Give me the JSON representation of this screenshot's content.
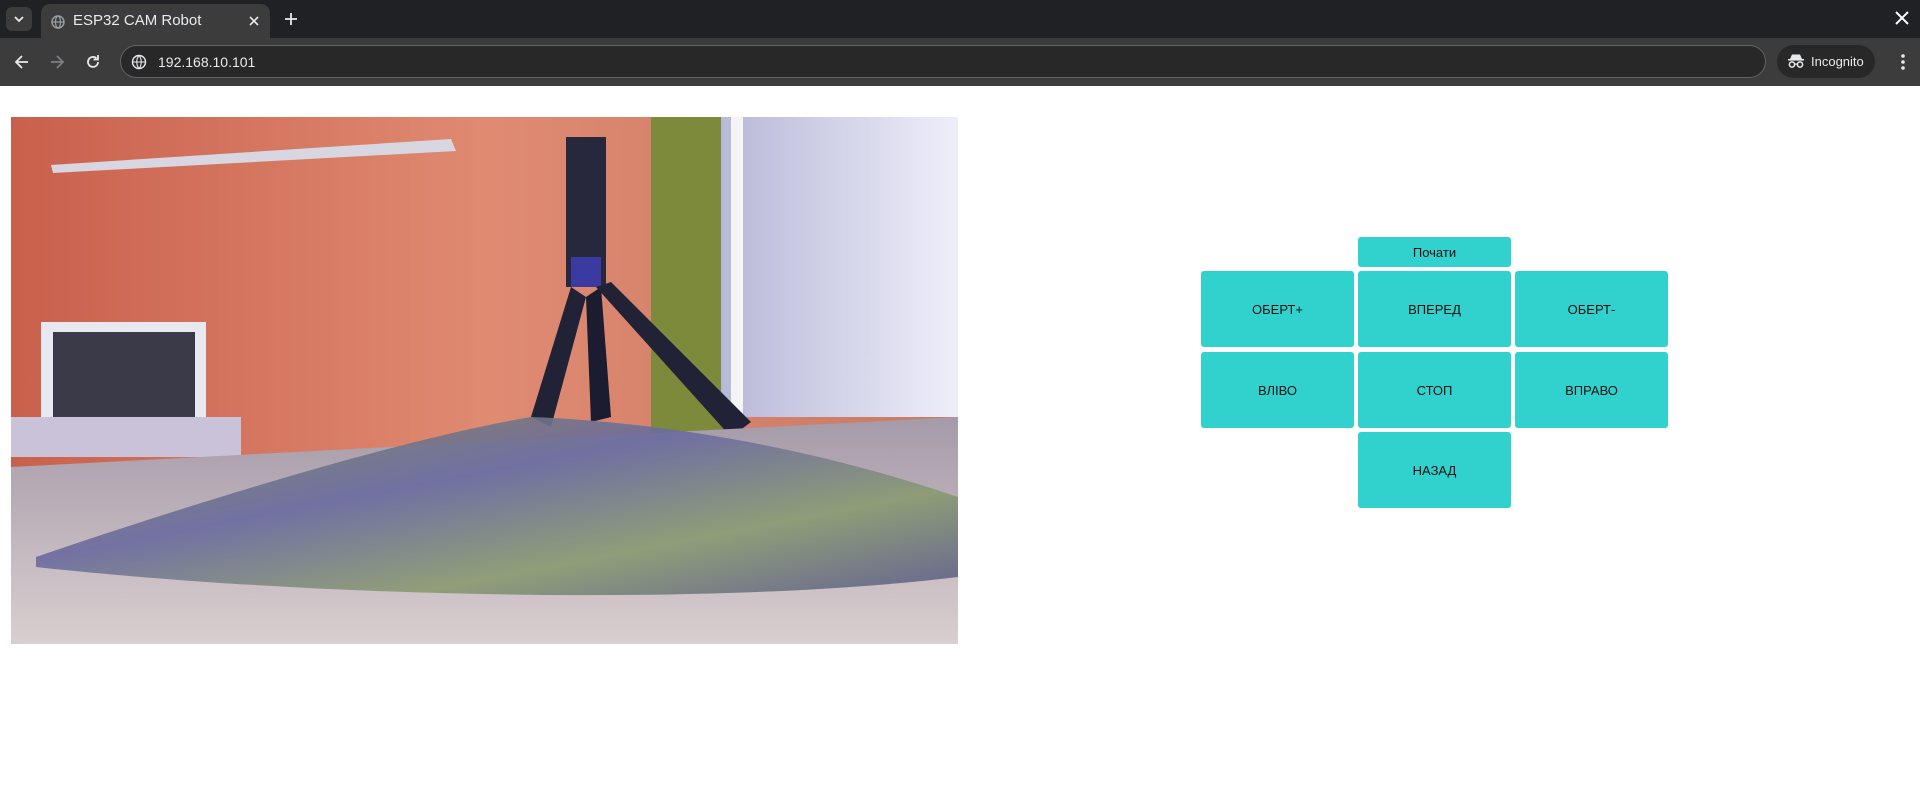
{
  "browser": {
    "tab_title": "ESP32 CAM Robot",
    "url": "192.168.10.101",
    "incognito_label": "Incognito"
  },
  "icons": {
    "tab_search": "chevron-down-icon",
    "favicon": "globe-icon",
    "tab_close": "close-icon",
    "new_tab": "plus-icon",
    "window_close": "close-icon",
    "back": "arrow-left-icon",
    "forward": "arrow-right-icon",
    "reload": "reload-icon",
    "site_info": "site-info-icon",
    "incognito": "incognito-icon",
    "menu": "kebab-menu-icon"
  },
  "camera": {
    "description_colors": {
      "wall": "#d9705a",
      "table": "#7a6e9a"
    }
  },
  "controls": {
    "start_label": "Почати",
    "rotate_plus_label": "ОБЕРТ+",
    "forward_label": "ВПЕРЕД",
    "rotate_minus_label": "ОБЕРТ-",
    "left_label": "ВЛІВО",
    "stop_label": "СТОП",
    "right_label": "ВПРАВО",
    "back_label": "НАЗАД",
    "button_color": "#31d2cd"
  }
}
